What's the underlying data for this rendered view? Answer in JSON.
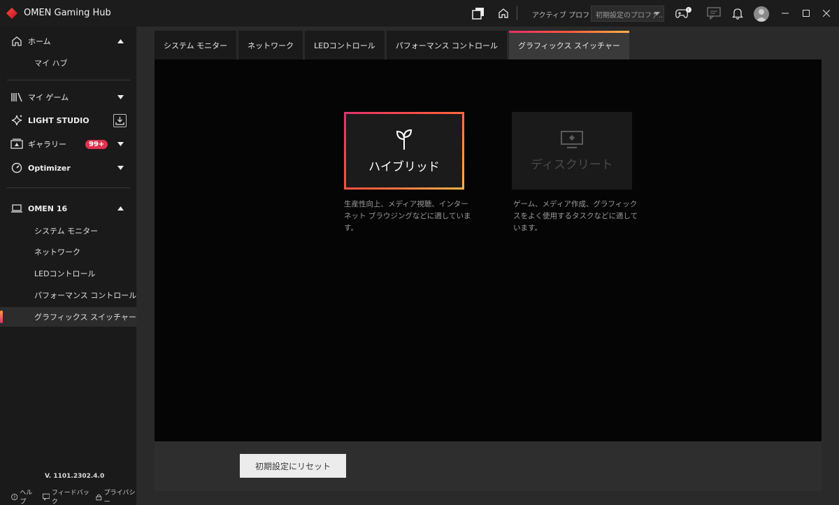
{
  "window": {
    "title": "OMEN Gaming Hub",
    "active_profile_label": "アクティブ プロファイル",
    "profile_select_value": "初期設定のプロファ..."
  },
  "sidebar": {
    "home": {
      "label": "ホーム",
      "sub": [
        "マイ ハブ"
      ]
    },
    "my_games": {
      "label": "マイ ゲーム"
    },
    "light_studio": {
      "label": "LIGHT STUDIO"
    },
    "gallery": {
      "label": "ギャラリー",
      "badge": "99+"
    },
    "optimizer": {
      "label": "Optimizer"
    },
    "device": {
      "label": "OMEN 16",
      "sub": [
        "システム モニター",
        "ネットワーク",
        "LEDコントロール",
        "パフォーマンス コントロール",
        "グラフィックス スイッチャー"
      ],
      "selected_index": 4
    },
    "version": "V. 1101.2302.4.0",
    "footer": {
      "help": "ヘルプ",
      "feedback": "フィードバック",
      "privacy": "プライバシー"
    }
  },
  "tabs": [
    {
      "label": "システム モニター",
      "active": false
    },
    {
      "label": "ネットワーク",
      "active": false
    },
    {
      "label": "LEDコントロール",
      "active": false
    },
    {
      "label": "パフォーマンス コントロール",
      "active": false
    },
    {
      "label": "グラフィックス スイッチャー",
      "active": true
    }
  ],
  "graphics_modes": {
    "hybrid": {
      "name": "ハイブリッド",
      "icon": "sprout-icon",
      "selected": true,
      "description": "生産性向上、メディア視聴、インターネット ブラウジングなどに適しています。"
    },
    "discrete": {
      "name": "ディスクリート",
      "icon": "monitor-icon",
      "selected": false,
      "description": "ゲーム、メディア作成、グラフィックスをよく使用するタスクなどに適しています。"
    }
  },
  "reset_button": "初期設定にリセット",
  "colors": {
    "accent_gradient_start": "#e2306c",
    "accent_gradient_mid": "#ff5a3c",
    "accent_gradient_end": "#ffb347",
    "badge": "#e0324f",
    "logo": "#e62b2b"
  }
}
